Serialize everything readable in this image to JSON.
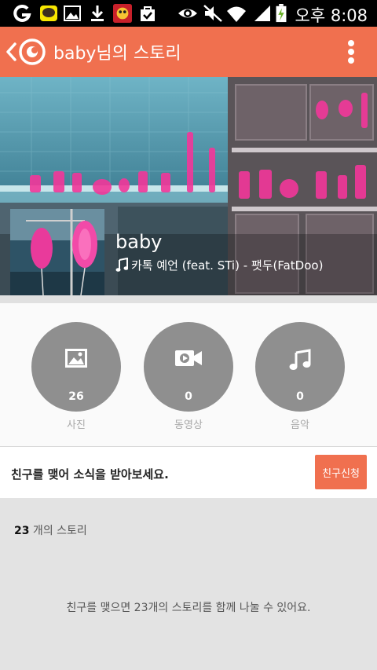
{
  "status_bar": {
    "time": "오후 8:08",
    "icons": [
      "g-icon",
      "kakaotalk-icon",
      "image-icon",
      "download-icon",
      "game-icon",
      "bag-check-icon",
      "eye-icon",
      "mute-icon",
      "wifi-icon",
      "signal-icon",
      "battery-charging-icon"
    ]
  },
  "app_bar": {
    "title": "baby님의 스토리",
    "back_icon": "chevron-left-icon",
    "logo_icon": "kakaostory-logo",
    "menu_icon": "more-vert-icon",
    "accent_color": "#f0704f"
  },
  "profile": {
    "name": "baby",
    "song": "카톡 예언 (feat. STi) - 팻두(FatDoo)",
    "song_icon": "music-note-icon"
  },
  "media": [
    {
      "icon": "image-icon",
      "count": "26",
      "label": "사진"
    },
    {
      "icon": "video-icon",
      "count": "0",
      "label": "동영상"
    },
    {
      "icon": "music-icon",
      "count": "0",
      "label": "음악"
    }
  ],
  "friend": {
    "message": "친구를 맺어 소식을 받아보세요.",
    "button": "친구신청"
  },
  "stories": {
    "count": "23",
    "count_suffix": " 개의 스토리",
    "message": "친구를 맺으면 23개의 스토리를 함께 나눌 수 있어요."
  }
}
